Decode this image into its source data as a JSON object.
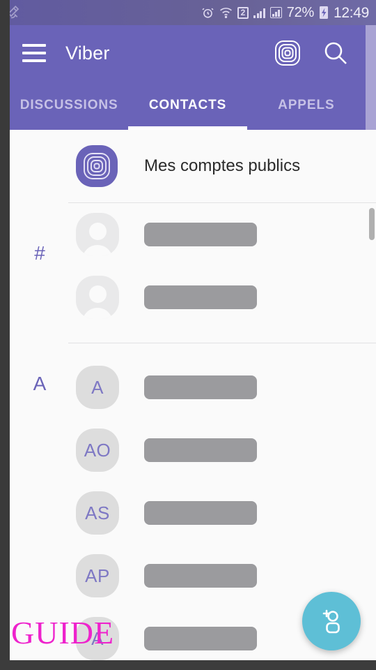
{
  "status_bar": {
    "left_icon": "satellite-icon",
    "icons": [
      "alarm-icon",
      "wifi-icon",
      "sim-badge-2",
      "signal-bars-icon",
      "signal-box-icon"
    ],
    "sim_badge": "2",
    "battery_percent": "72%",
    "battery_state_icon": "charging-bolt-icon",
    "clock": "12:49"
  },
  "app_bar": {
    "menu_icon": "hamburger-menu-icon",
    "title": "Viber",
    "public_accounts_icon": "concentric-rings-icon",
    "search_icon": "search-icon",
    "background_color": "#6a63b8"
  },
  "tabs": {
    "items": [
      {
        "label": "DISCUSSIONS",
        "active": false
      },
      {
        "label": "CONTACTS",
        "active": true
      },
      {
        "label": "APPELS",
        "active": false
      }
    ],
    "active_index": 1,
    "indicator_color": "#ffffff"
  },
  "public_accounts_row": {
    "icon": "concentric-rings-squircle-icon",
    "label": "Mes comptes publics"
  },
  "sections": [
    {
      "letter": "#",
      "contacts": [
        {
          "avatar_type": "photo-placeholder",
          "avatar_text": "",
          "name_redacted": true,
          "name_bar_width": 162
        },
        {
          "avatar_type": "photo-placeholder",
          "avatar_text": "",
          "name_redacted": true,
          "name_bar_width": 162
        }
      ]
    },
    {
      "letter": "A",
      "contacts": [
        {
          "avatar_type": "initials",
          "avatar_text": "A",
          "name_redacted": true,
          "name_bar_width": 162
        },
        {
          "avatar_type": "initials",
          "avatar_text": "AO",
          "name_redacted": true,
          "name_bar_width": 162
        },
        {
          "avatar_type": "initials",
          "avatar_text": "AS",
          "name_redacted": true,
          "name_bar_width": 162
        },
        {
          "avatar_type": "initials",
          "avatar_text": "AP",
          "name_redacted": true,
          "name_bar_width": 162
        },
        {
          "avatar_type": "initials",
          "avatar_text": "A",
          "name_redacted": true,
          "name_bar_width": 162
        }
      ]
    }
  ],
  "fab": {
    "icon": "add-contact-icon",
    "color": "#5ebfd6"
  },
  "watermark": {
    "text": "GUIDE",
    "color": "#ee22cc"
  },
  "scrollbar": {
    "visible": true
  }
}
